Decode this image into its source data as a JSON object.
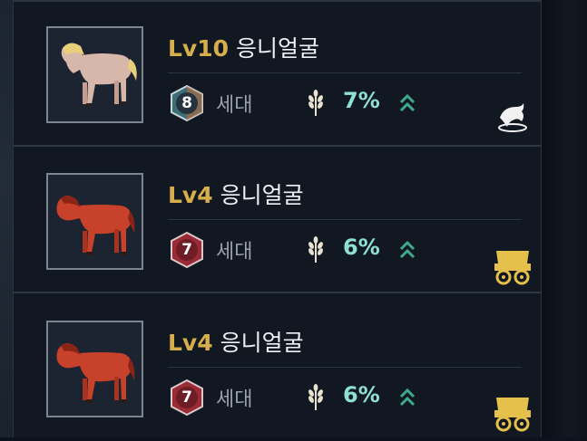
{
  "horses": [
    {
      "level": "Lv10",
      "name": "응니얼굴",
      "generation": "8",
      "generation_label": "세대",
      "growth": "7%",
      "coat": "#d7b7a9",
      "mane": "#e8d07a",
      "badge_color": "#3a6f76",
      "action_icon": "dolphin-icon"
    },
    {
      "level": "Lv4",
      "name": "응니얼굴",
      "generation": "7",
      "generation_label": "세대",
      "growth": "6%",
      "coat": "#c8412a",
      "mane": "#8a2416",
      "badge_color": "#9a2b36",
      "action_icon": "wagon-icon"
    },
    {
      "level": "Lv4",
      "name": "응니얼굴",
      "generation": "7",
      "generation_label": "세대",
      "growth": "6%",
      "coat": "#c8412a",
      "mane": "#8a2416",
      "badge_color": "#9a2b36",
      "action_icon": "wagon-icon"
    }
  ],
  "colors": {
    "level": "#d6ae4c",
    "growth": "#8fe0d0",
    "up_arrow": "#3faa8a",
    "gold_icon": "#e5c04a"
  }
}
